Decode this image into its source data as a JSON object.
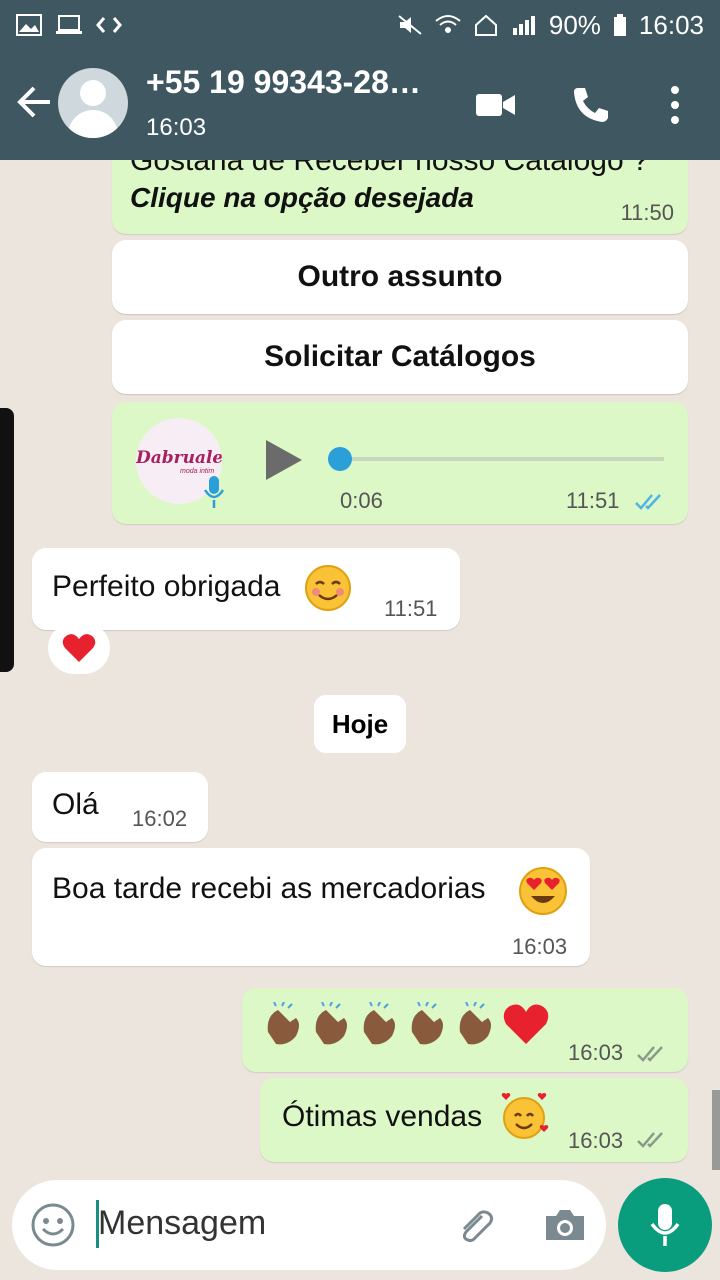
{
  "status_bar": {
    "battery": "90%",
    "time": "16:03",
    "icons": [
      "image-icon",
      "laptop-icon",
      "code-icon",
      "mute-icon",
      "wifi-icon",
      "home-icon",
      "signal-icon",
      "battery-icon"
    ]
  },
  "header": {
    "contact_name": "+55 19 99343-28…",
    "subtitle": "16:03",
    "icons": [
      "back-arrow-icon",
      "video-call-icon",
      "phone-icon",
      "more-vert-icon"
    ],
    "color": "#3e5760"
  },
  "messages": {
    "top_bubble": {
      "partial_text": "Gostaria de Receber nosso Catálogo ?",
      "cta": "Clique na opção desejada",
      "time": "11:50"
    },
    "quick_replies": [
      "Outro assunto",
      "Solicitar Catálogos"
    ],
    "voice": {
      "logo_text": "Dabruale",
      "logo_sub": "moda intim",
      "duration": "0:06",
      "time": "11:51",
      "progress": 0
    },
    "perfeito": {
      "text": "Perfeito obrigada",
      "time": "11:51"
    },
    "reaction_icon": "heart-icon",
    "day_chip": "Hoje",
    "ola": {
      "text": "Olá",
      "time": "16:02"
    },
    "boa_tarde": {
      "text": "Boa tarde recebi as mercadorias",
      "time": "16:03"
    },
    "clap": {
      "time": "16:03"
    },
    "otimas": {
      "text": "Ótimas vendas",
      "time": "16:03"
    }
  },
  "composer": {
    "placeholder": "Mensagem",
    "icons": [
      "emoji-icon",
      "attach-icon",
      "camera-icon",
      "mic-icon"
    ]
  },
  "colors": {
    "outgoing": "#dcf8c6",
    "incoming": "#ffffff",
    "accent": "#0a9d7d",
    "read_ticks": "#4fb3e6"
  }
}
